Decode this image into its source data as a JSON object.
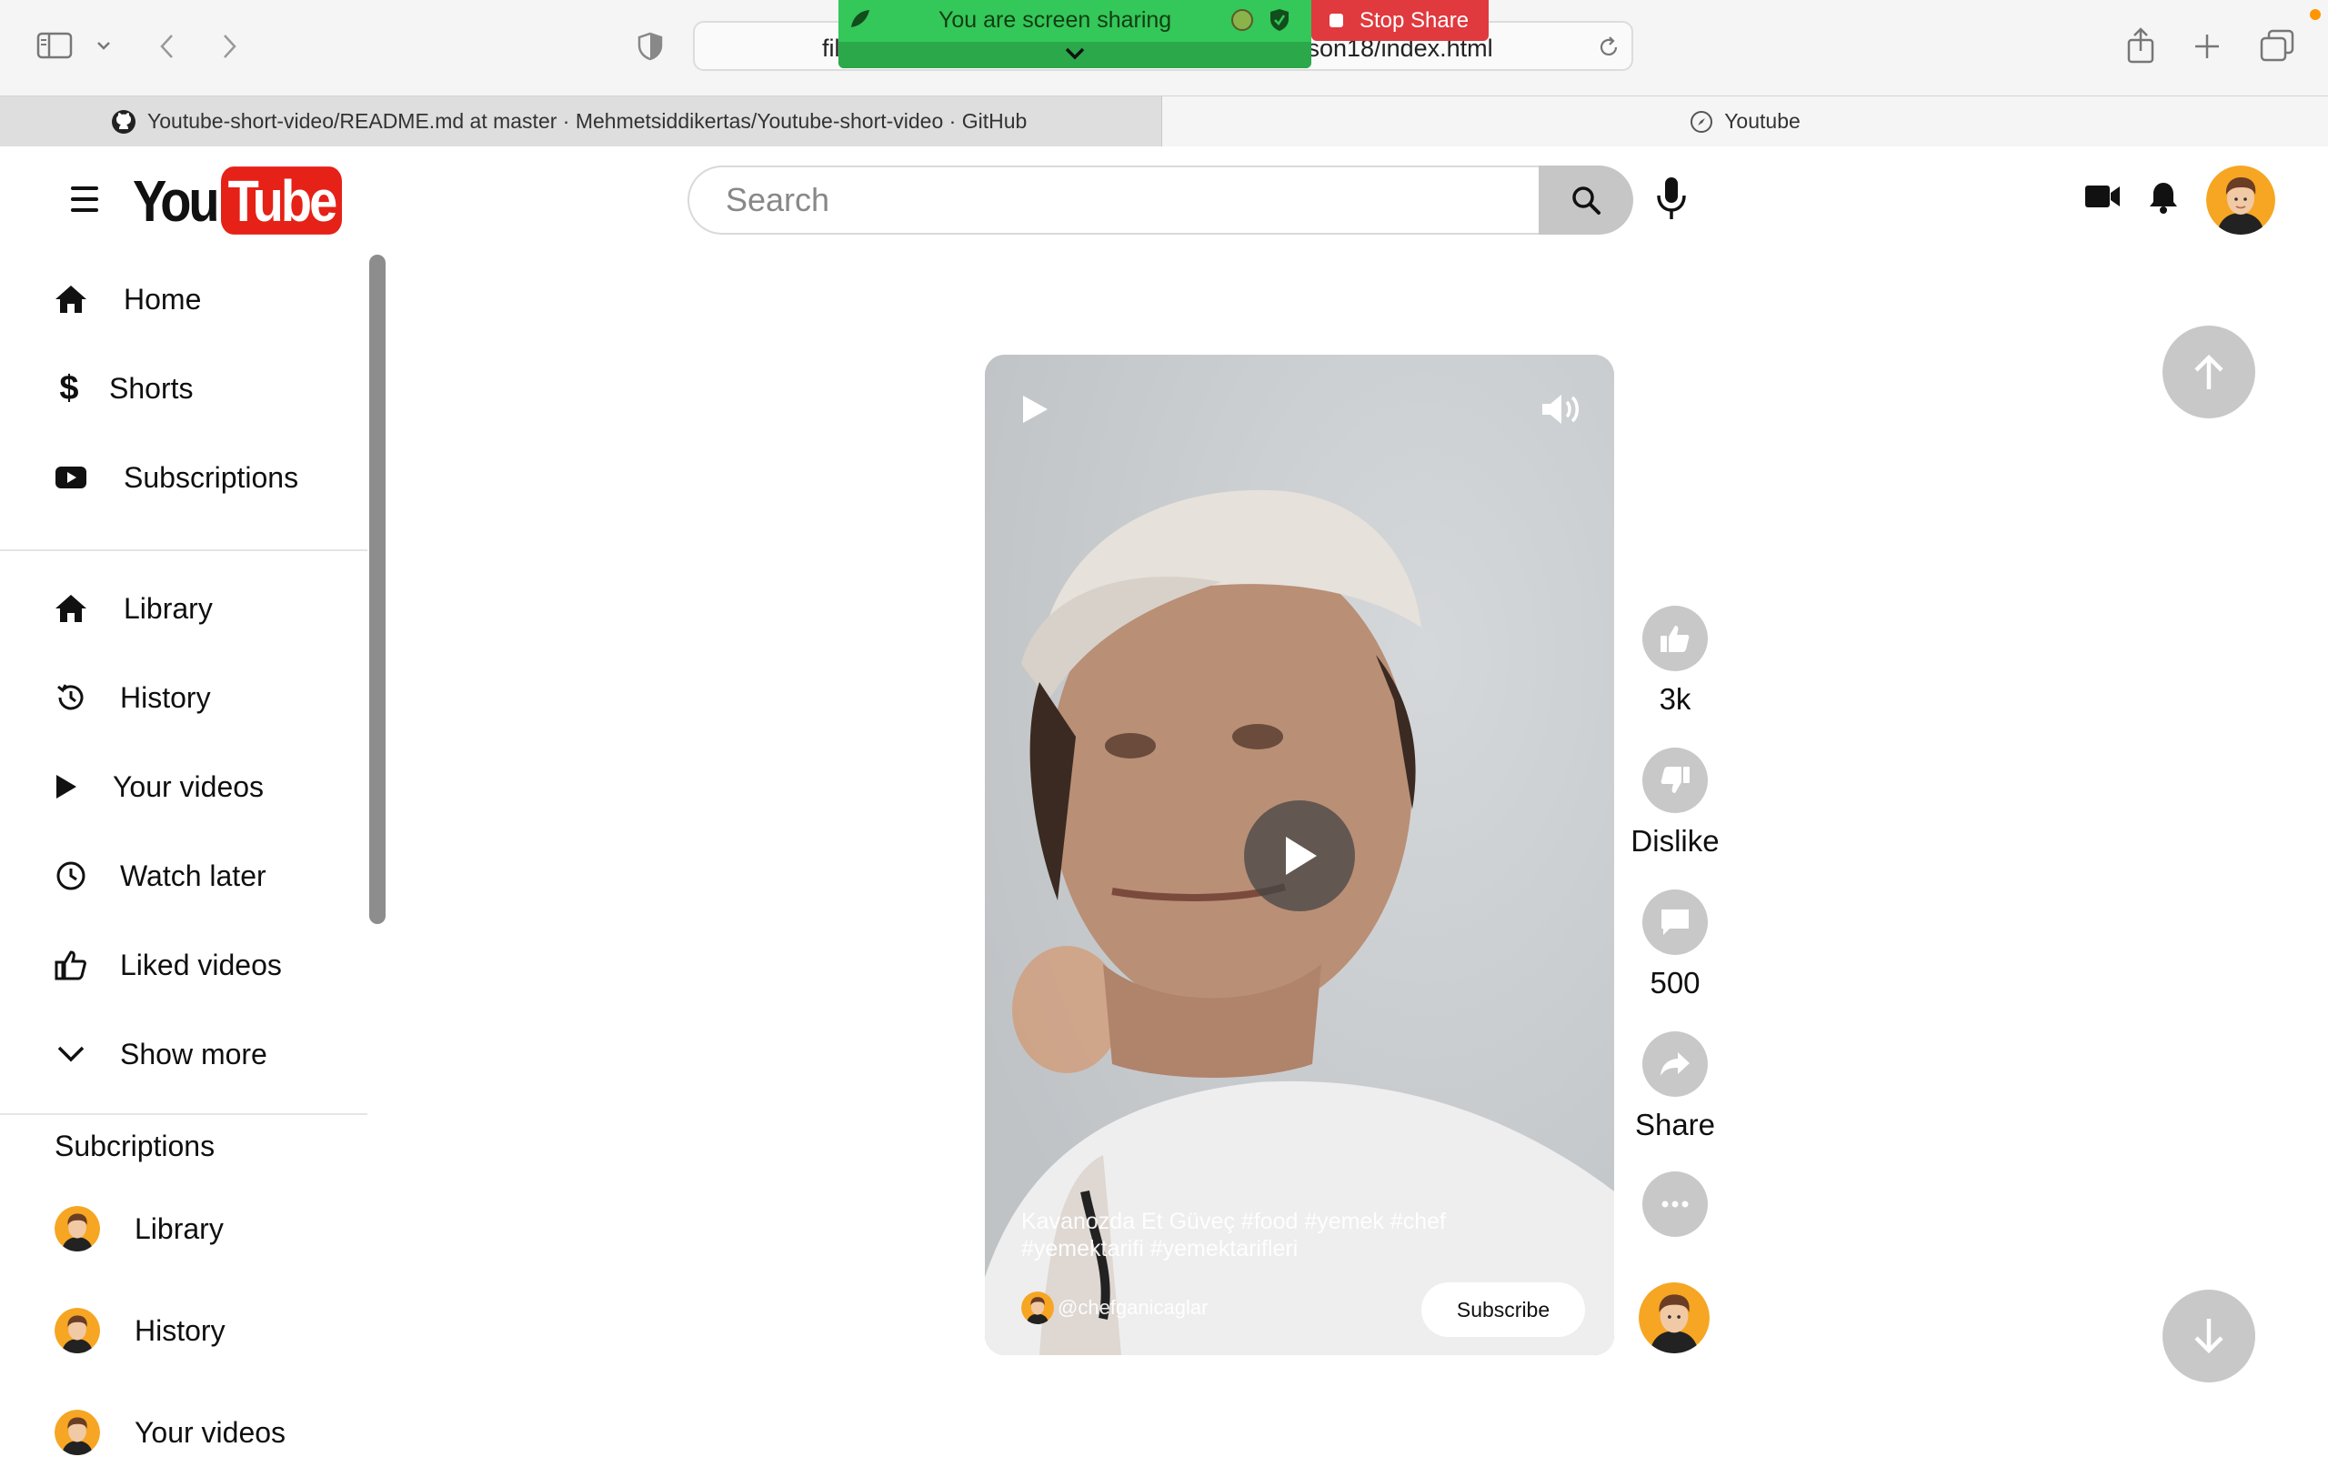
{
  "browser": {
    "url_left": "fil",
    "url_right": "sson18/index.html",
    "screen_share_text": "You are screen sharing",
    "stop_share_label": "Stop Share",
    "tabs": [
      {
        "label": "Youtube-short-video/README.md at master · Mehmetsiddikertas/Youtube-short-video · GitHub",
        "icon": "github-icon"
      },
      {
        "label": "Youtube",
        "icon": "compass-icon"
      }
    ]
  },
  "header": {
    "logo_you": "You",
    "logo_tube": "Tube",
    "search_placeholder": "Search"
  },
  "sidebar": {
    "main": [
      {
        "label": "Home",
        "icon": "home-icon"
      },
      {
        "label": "Shorts",
        "icon": "dollar-icon"
      },
      {
        "label": "Subscriptions",
        "icon": "youtube-icon"
      }
    ],
    "library": [
      {
        "label": "Library",
        "icon": "home-icon"
      },
      {
        "label": "History",
        "icon": "history-icon"
      },
      {
        "label": "Your videos",
        "icon": "play-icon"
      },
      {
        "label": "Watch later",
        "icon": "clock-icon"
      },
      {
        "label": "Liked videos",
        "icon": "thumbs-up-icon"
      },
      {
        "label": "Show more",
        "icon": "chevron-down-icon"
      }
    ],
    "subscriptions_heading": "Subcriptions",
    "subscriptions": [
      {
        "label": "Library"
      },
      {
        "label": "History"
      },
      {
        "label": "Your videos"
      }
    ]
  },
  "short": {
    "caption": "Kavanozda Et Güveç #food #yemek #chef #yemektarifi #yemektarifleri",
    "channel": "@chefganicaglar",
    "subscribe_label": "Subscribe"
  },
  "actions": {
    "like_label": "3k",
    "dislike_label": "Dislike",
    "comment_label": "500",
    "share_label": "Share"
  },
  "colors": {
    "brand_red": "#e62117",
    "share_green": "#34c759",
    "stop_red": "#e0393e",
    "action_grey": "#c8c8c8"
  }
}
